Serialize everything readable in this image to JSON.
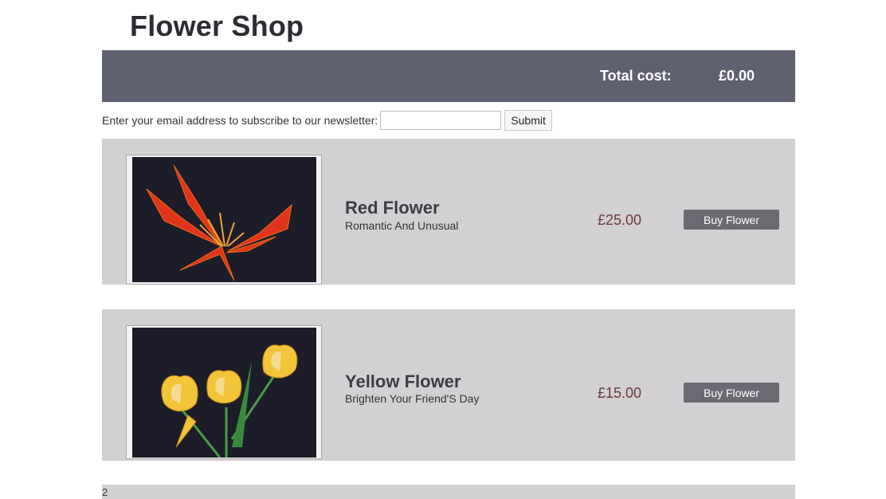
{
  "header": {
    "title": "Flower Shop"
  },
  "cart": {
    "total_label": "Total cost:",
    "total_value": "£0.00"
  },
  "newsletter": {
    "prompt": "Enter your email address to subscribe to our newsletter:",
    "email_value": "",
    "submit_label": "Submit"
  },
  "products": [
    {
      "index": "0",
      "name": "Red Flower",
      "tagline": "Romantic And Unusual",
      "price": "£25.00",
      "buy_label": "Buy Flower",
      "image_icon": "red-flower-photo"
    },
    {
      "index": "1",
      "name": "Yellow Flower",
      "tagline": "Brighten Your Friend'S Day",
      "price": "£15.00",
      "buy_label": "Buy Flower",
      "image_icon": "yellow-tulips-photo"
    },
    {
      "index": "2"
    }
  ],
  "colors": {
    "cart_bar": "#5f6170",
    "product_bg": "#d2d0d3",
    "price": "#6e3a3a",
    "buy_button": "#6a6a72"
  }
}
